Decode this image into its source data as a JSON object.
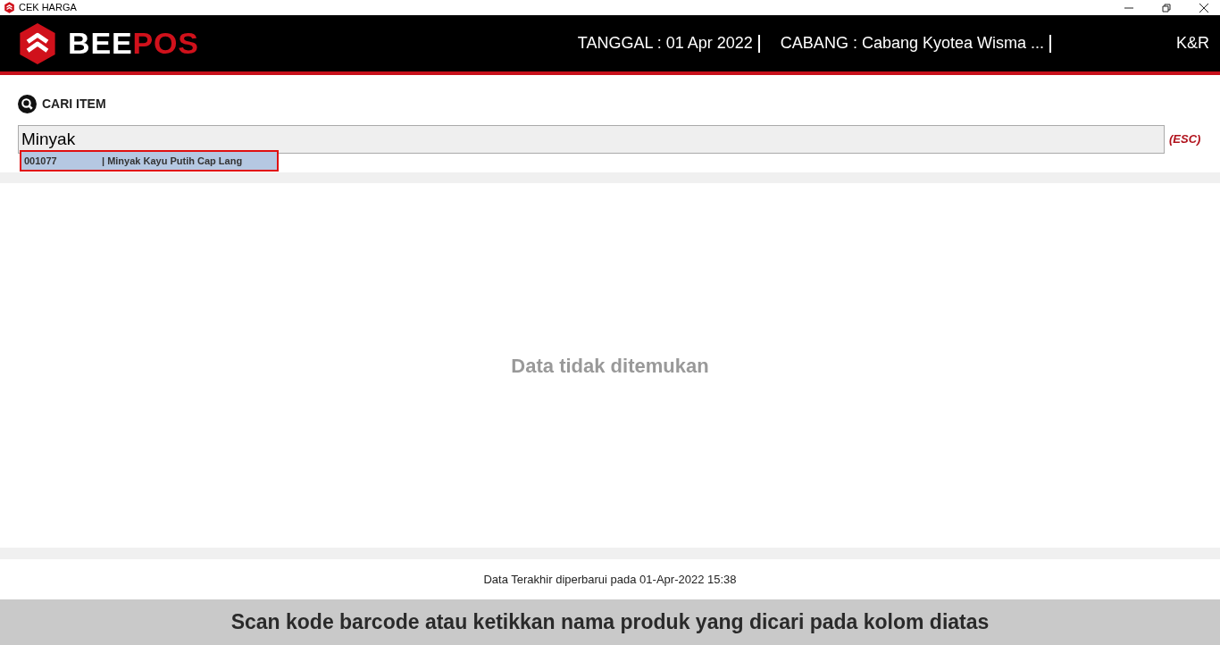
{
  "window": {
    "title": "CEK HARGA"
  },
  "header": {
    "logo_parts": [
      "BEE",
      "POS"
    ],
    "date": "TANGGAL : 01 Apr 2022",
    "branch": "CABANG : Cabang Kyotea Wisma ...",
    "user": "K&R"
  },
  "search": {
    "label": "CARI ITEM",
    "value": "Minyak",
    "esc_hint": "(ESC)",
    "suggestions": [
      {
        "code": "001077",
        "name": "| Minyak Kayu Putih Cap Lang",
        "selected": true
      }
    ]
  },
  "result": {
    "message": "Data tidak ditemukan"
  },
  "footer": {
    "updated": "Data Terakhir diperbarui pada 01-Apr-2022 15:38",
    "instruction": "Scan kode barcode atau ketikkan nama produk yang dicari pada kolom diatas"
  }
}
